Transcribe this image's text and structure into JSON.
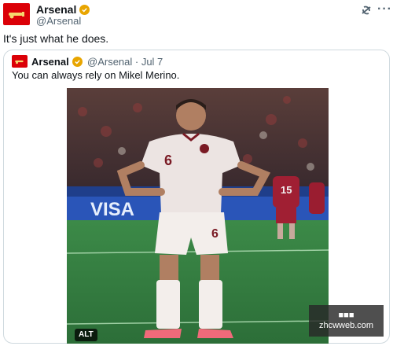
{
  "tweet": {
    "author_name": "Arsenal",
    "author_handle": "@Arsenal",
    "text": "It's just what he does.",
    "more_label": "···"
  },
  "quoted": {
    "author_name": "Arsenal",
    "meta": "@Arsenal · Jul 7",
    "text": "You can always rely on Mikel Merino.",
    "alt_badge": "ALT",
    "photo": {
      "jersey_number": "6",
      "opponent_number": "15",
      "board_text": "VISA"
    }
  },
  "watermark": {
    "line1": "■■■",
    "line2": "zhcwweb.com"
  },
  "colors": {
    "brand_red": "#db0007",
    "verified_gold": "#e8a500",
    "muted": "#536471",
    "border": "#cfd9de"
  },
  "icons": [
    "cannon-icon",
    "verified-badge-icon",
    "grok-icon",
    "more-icon"
  ]
}
